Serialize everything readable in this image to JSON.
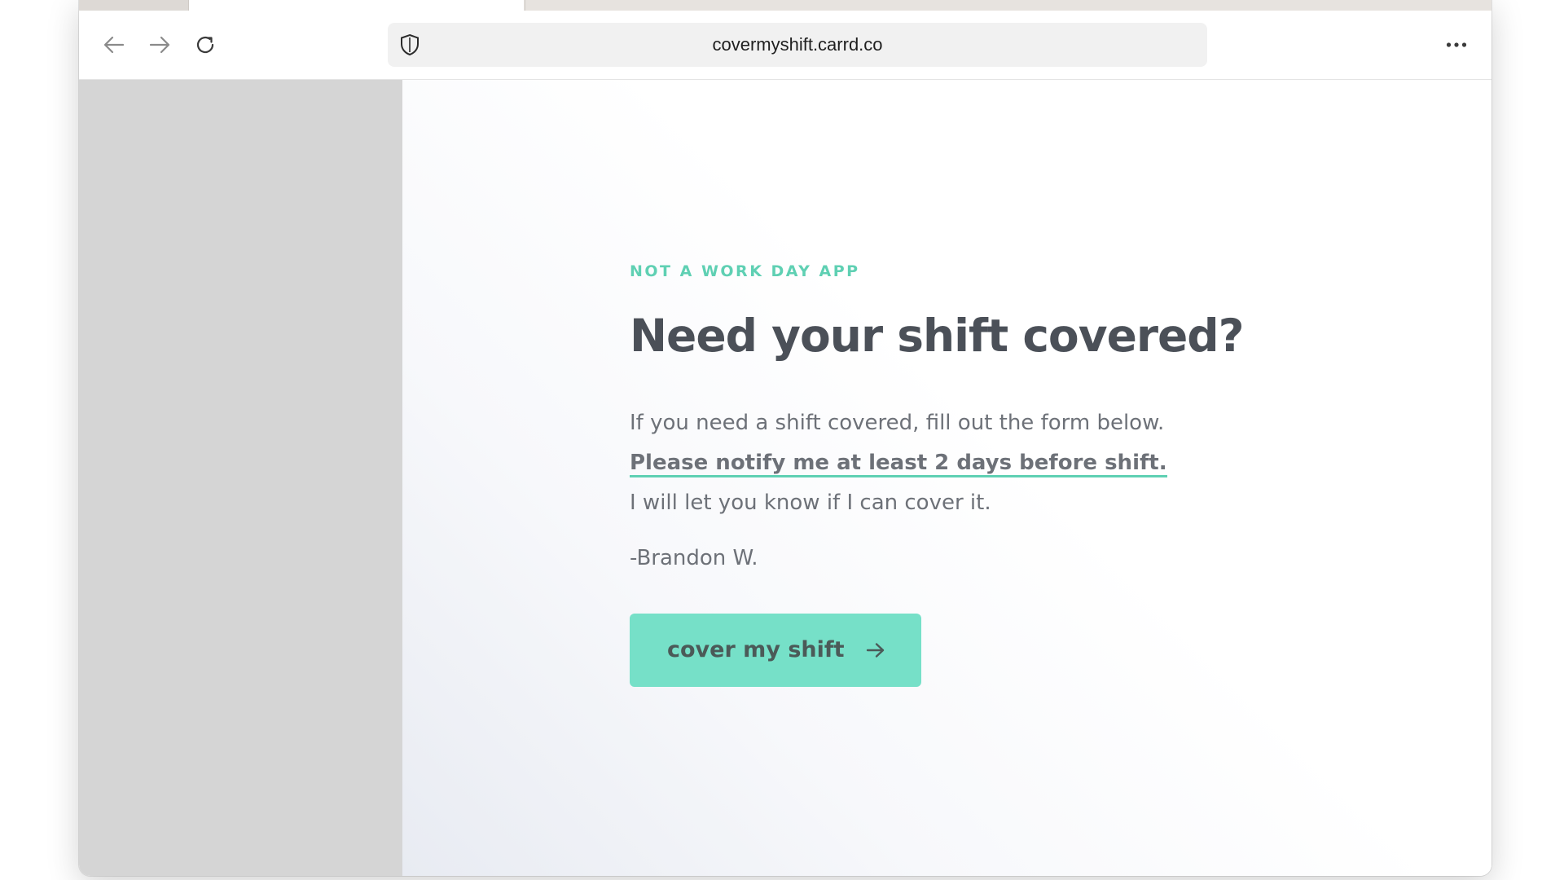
{
  "browser": {
    "url": "covermyshift.carrd.co",
    "icons": {
      "back": "arrow-left-icon",
      "forward": "arrow-right-icon",
      "reload": "reload-icon",
      "shield": "shield-icon",
      "menu": "more-horizontal-icon"
    }
  },
  "page": {
    "eyebrow": "NOT A WORK DAY APP",
    "headline": "Need your shift covered?",
    "body": {
      "line1": "If you need a shift covered, fill out the form below.",
      "line2": "Please notify me at least 2 days before shift.",
      "line3": "I will let you know if I can cover it."
    },
    "signature": "-Brandon W.",
    "cta": {
      "label": "cover my shift",
      "icon": "arrow-right-icon"
    }
  },
  "colors": {
    "accent": "#5fd0b3",
    "button": "#76e0c8",
    "heading": "#4b5058",
    "text": "#6d7178",
    "side_panel": "#d5d5d5"
  }
}
